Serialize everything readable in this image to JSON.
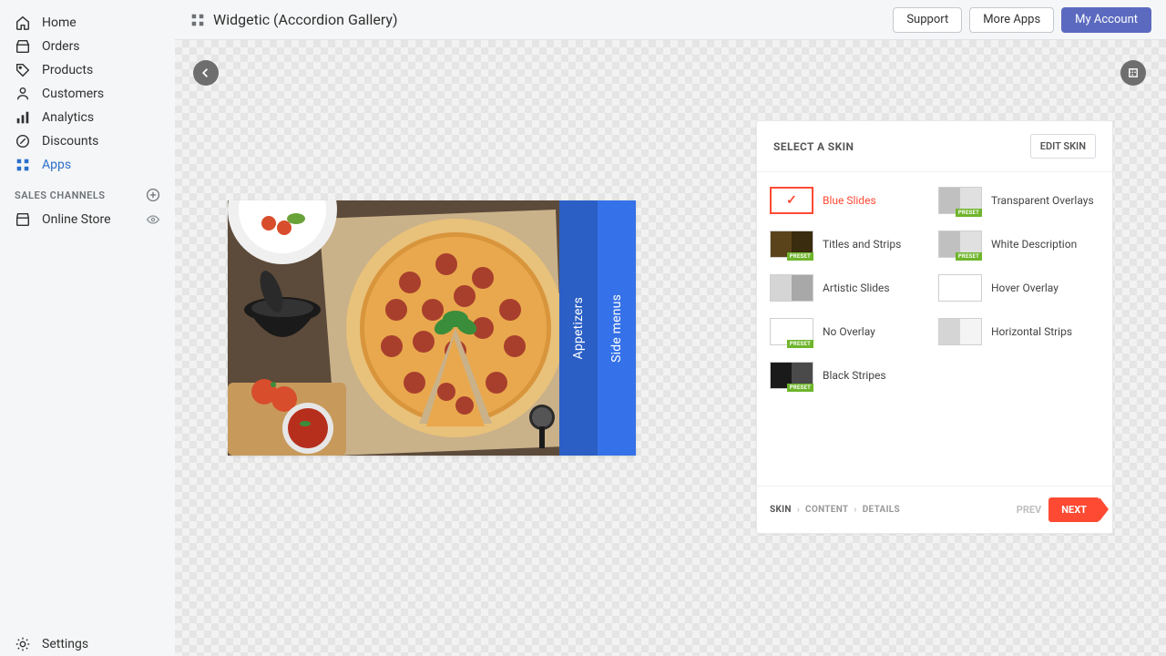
{
  "sidebar": {
    "items": [
      {
        "label": "Home",
        "icon": "home-icon"
      },
      {
        "label": "Orders",
        "icon": "orders-icon"
      },
      {
        "label": "Products",
        "icon": "products-icon"
      },
      {
        "label": "Customers",
        "icon": "customers-icon"
      },
      {
        "label": "Analytics",
        "icon": "analytics-icon"
      },
      {
        "label": "Discounts",
        "icon": "discounts-icon"
      },
      {
        "label": "Apps",
        "icon": "apps-icon",
        "active": true
      }
    ],
    "sales_channels_label": "SALES CHANNELS",
    "online_store_label": "Online Store",
    "settings_label": "Settings"
  },
  "topbar": {
    "title": "Widgetic (Accordion Gallery)",
    "support": "Support",
    "more_apps": "More Apps",
    "my_account": "My Account"
  },
  "accordion": {
    "slide2": "Appetizers",
    "slide3": "Side menus"
  },
  "panel": {
    "title": "SELECT A SKIN",
    "edit_skin": "EDIT SKIN",
    "skins": [
      {
        "name": "Blue Slides",
        "selected": true,
        "half_l": "#ffffff",
        "half_r": "#ffffff",
        "preset": false
      },
      {
        "name": "Transparent Overlays",
        "half_l": "#c0c0c0",
        "half_r": "#e0e0e0",
        "preset": true
      },
      {
        "name": "Titles and Strips",
        "half_l": "#5a431a",
        "half_r": "#3a2c0f",
        "preset": true
      },
      {
        "name": "White Description",
        "half_l": "#c0c0c0",
        "half_r": "#e0e0e0",
        "preset": true
      },
      {
        "name": "Artistic Slides",
        "half_l": "#d5d5d5",
        "half_r": "#a8a8a8",
        "preset": false
      },
      {
        "name": "Hover Overlay",
        "half_l": "#ffffff",
        "half_r": "#ffffff",
        "preset": false
      },
      {
        "name": "No Overlay",
        "half_l": "#ffffff",
        "half_r": "#ffffff",
        "preset": true
      },
      {
        "name": "Horizontal Strips",
        "half_l": "#d5d5d5",
        "half_r": "#f4f4f4",
        "preset": false
      },
      {
        "name": "Black Stripes",
        "half_l": "#1a1a1a",
        "half_r": "#4a4a4a",
        "preset": true
      }
    ],
    "steps": {
      "skin": "SKIN",
      "content": "CONTENT",
      "details": "DETAILS"
    },
    "prev": "PREV",
    "next": "NEXT",
    "preset_badge": "PRESET"
  }
}
